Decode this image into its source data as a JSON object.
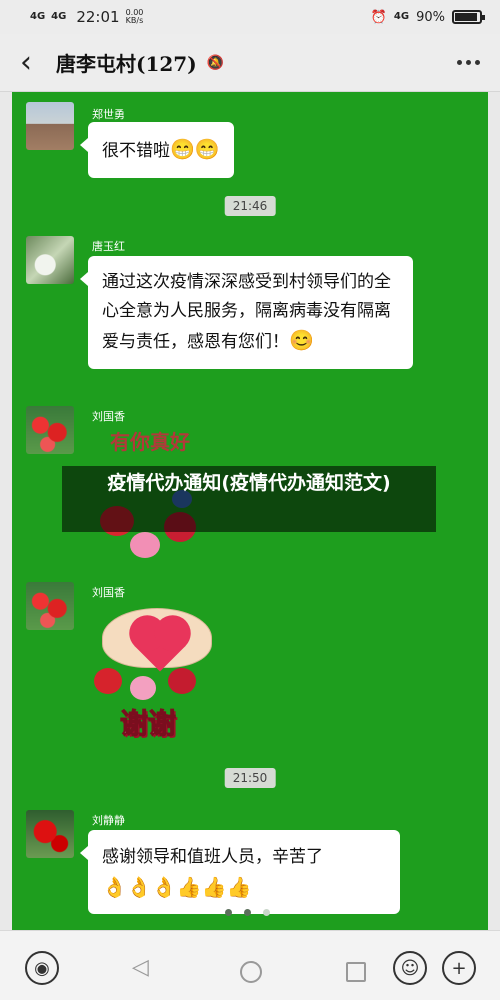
{
  "status_bar": {
    "signal_1": "4G",
    "signal_2": "4G",
    "time": "22:01",
    "speed_value": "0.00",
    "speed_unit": "KB/s",
    "network": "4G",
    "battery": "90%",
    "battery_level": 0.9
  },
  "header": {
    "title": "唐李屯村(127)",
    "back_icon": "chevron-left-icon",
    "mute_icon": "bell-off-icon",
    "more_icon": "more-dots-icon"
  },
  "messages": [
    {
      "sender": "郑世勇",
      "text": "很不错啦",
      "emoji": "😁😁"
    },
    {
      "timestamp": "21:46"
    },
    {
      "sender": "唐玉红",
      "text": "通过这次疫情深深感受到村领导们的全心全意为人民服务，隔离病毒没有隔离爱与责任，感恩有您们！",
      "emoji": "😊"
    },
    {
      "sender": "刘国香",
      "sticker_text": "有你真好"
    },
    {
      "sender": "刘国香",
      "sticker_text": "谢谢"
    },
    {
      "timestamp": "21:50"
    },
    {
      "sender": "刘静静",
      "text": "感谢领导和值班人员，辛苦了",
      "emoji": "👌👌👌👍👍👍"
    }
  ],
  "overlay_title": "疫情代办通知(疫情代办通知范文)",
  "input_bar": {
    "voice_icon": "voice-icon",
    "emoji_icon": "smiley-icon",
    "add_icon": "plus-icon"
  },
  "nav": {
    "back_icon": "triangle-back-icon",
    "home_icon": "circle-home-icon",
    "recents_icon": "square-recents-icon"
  },
  "colors": {
    "chat_background": "#1e9e1e",
    "bubble": "#ffffff"
  }
}
